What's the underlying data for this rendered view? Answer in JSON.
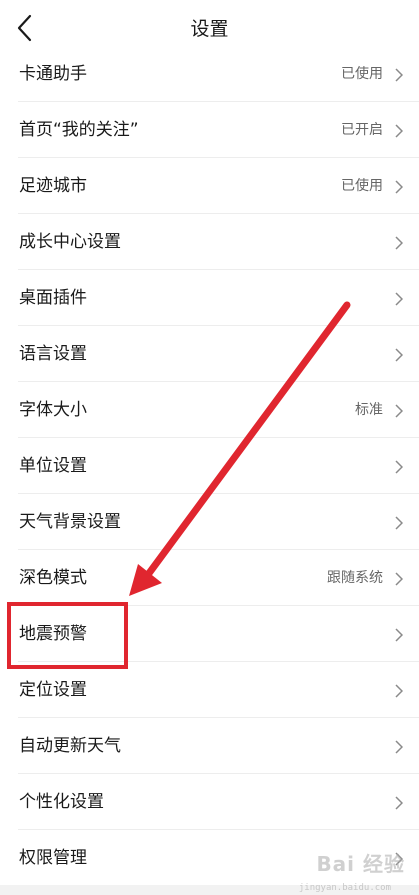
{
  "header": {
    "title": "设置",
    "back_icon": "chevron-left-icon"
  },
  "rows": [
    {
      "label": "卡通助手",
      "value": "已使用"
    },
    {
      "label": "首页“我的关注”",
      "value": "已开启"
    },
    {
      "label": "足迹城市",
      "value": "已使用"
    },
    {
      "label": "成长中心设置",
      "value": ""
    },
    {
      "label": "桌面插件",
      "value": ""
    },
    {
      "label": "语言设置",
      "value": ""
    },
    {
      "label": "字体大小",
      "value": "标准"
    },
    {
      "label": "单位设置",
      "value": ""
    },
    {
      "label": "天气背景设置",
      "value": ""
    },
    {
      "label": "深色模式",
      "value": "跟随系统"
    },
    {
      "label": "地震预警",
      "value": ""
    },
    {
      "label": "定位设置",
      "value": ""
    },
    {
      "label": "自动更新天气",
      "value": ""
    },
    {
      "label": "个性化设置",
      "value": ""
    },
    {
      "label": "权限管理",
      "value": ""
    }
  ],
  "annotation": {
    "color": "#e0262f",
    "highlighted_row": "地震预警"
  },
  "watermark": {
    "text": "Bai 经验",
    "sub": "jingyan.baidu.com"
  }
}
